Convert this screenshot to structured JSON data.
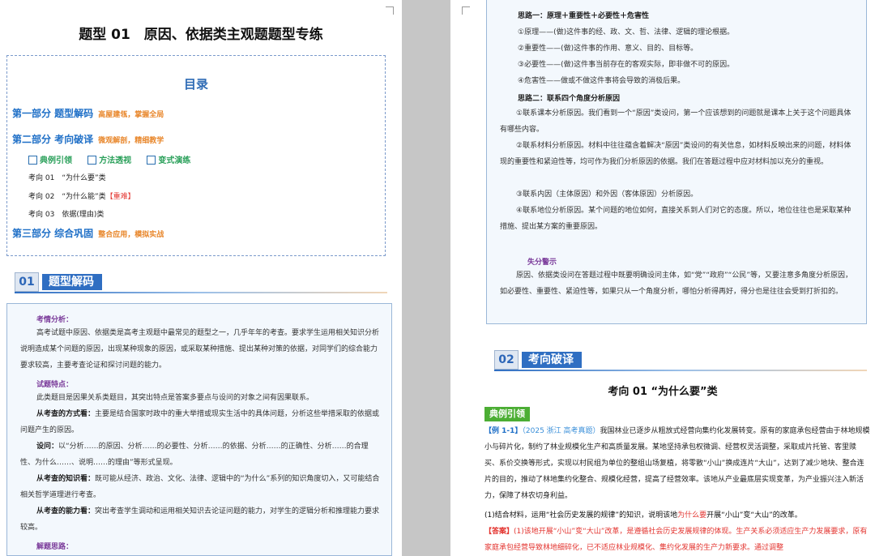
{
  "left_page": {
    "title": "题型 01　原因、依据类主观题题型专练",
    "toc": {
      "title": "目录",
      "parts": [
        {
          "label": "第一部分 题型解码",
          "tag": "高屋建瓴，掌握全局"
        },
        {
          "label": "第二部分 考向破译",
          "tag": "微观解剖，精细教学"
        },
        {
          "label": "第三部分 综合巩固",
          "tag": "整合应用，模拟实战"
        }
      ],
      "sublinks": [
        "典例引领",
        "方法透视",
        "变式演练"
      ],
      "items": [
        {
          "text": "考向 01　“为什么要”类",
          "extra": ""
        },
        {
          "text": "考向 02　“为什么能”类",
          "extra": "【重难】"
        },
        {
          "text": "考向 03　依据(理由)类",
          "extra": ""
        }
      ]
    },
    "section": {
      "num": "01",
      "name": "题型解码"
    },
    "analysis": {
      "h1": "考情分析：",
      "p1": "高考试题中原因、依据类是高考主观题中最常见的题型之一，几乎年年的考查。要求学生运用相关知识分析说明造成某个问题的原因，出现某种现象的原因，或采取某种措施、提出某种对策的依据，对同学们的综合能力要求较高，主要考查论证和探讨问题的能力。",
      "h2": "试题特点：",
      "p2": "此类题目是因果关系类题目，其突出特点是答案多要点与设问的对象之间有因果联系。",
      "p3_kw": "从考查的方式看：",
      "p3": "主要是结合国家时政中的重大举措或现实生活中的具体问题，分析这些举措采取的依据或问题产生的原因。",
      "p4_kw": "设问：",
      "p4": "以“分析……的原因、分析……的必要性、分析……的依据、分析……的正确性、分析……的合理性、为什么……、说明……的理由”等形式呈现。",
      "p5_kw": "从考查的知识看：",
      "p5": "既可能从经济、政治、文化、法律、逻辑中的“为什么”系列的知识角度切入，又可能结合相关哲学道理进行考查。",
      "p6_kw": "从考查的能力看：",
      "p6": "突出考查学生调动和运用相关知识去论证问题的能力，对学生的逻辑分析和推理能力要求较高。",
      "h3": "解题思路："
    }
  },
  "right_page": {
    "idea1": {
      "title": "思路一：原理＋重要性＋必要性＋危害性",
      "lines": [
        "①原理——(做)这件事的经、政、文、哲、法律、逻辑的理论根据。",
        "②重要性——(做)这件事的作用、意义、目的、目标等。",
        "③必要性——(做)这件事当前存在的客观实际，即非做不可的原因。",
        "④危害性——做或不做这件事将会导致的消极后果。"
      ]
    },
    "idea2": {
      "title": "思路二：联系四个角度分析原因",
      "lines": [
        "①联系课本分析原因。我们看到一个“原因”类设问，第一个应该想到的问题就是课本上关于这个问题具体有哪些内容。",
        "②联系材料分析原因。材料中往往蕴含着解决“原因”类设问的有关信息，如材料反映出来的问题，材料体现的重要性和紧迫性等，均可作为我们分析原因的依据。我们在答题过程中应对材料加以充分的重视。",
        "③联系内因（主体原因）和外因（客体原因）分析原因。",
        "④联系地位分析原因。某个问题的地位如何，直接关系到人们对它的态度。所以，地位往往也是采取某种措施、提出某方案的重要原因。"
      ]
    },
    "warning": {
      "title": "失分警示",
      "text": "原因、依据类设问在答题过程中既要明确设问主体，如“党”“政府”“公民”等，又要注意多角度分析原因，如必要性、重要性、紧迫性等，如果只从一个角度分析，哪怕分析得再好，得分也是往往会受到打折扣的。"
    },
    "section": {
      "num": "02",
      "name": "考向破译"
    },
    "topic_title": "考向 01 “为什么要”类",
    "example_tag": "典例引领",
    "example": {
      "label": "【例 1-1】",
      "source": "（2025 浙江 高考真题）",
      "text": "我国林业已逐步从粗放式经营向集约化发展转变。原有的家庭承包经营由于林地规模小与碎片化，制约了林业规模化生产和高质量发展。某地坚持承包权微调、经营权灵活调整，采取成片托管、客里赎买、系价交换等形式，实现以村民组为单位的整组山场复植，将零散“小山”换成连片“大山”，达到了减少地块、整合连片的目的，推动了林地集约化整合、规模化经营，提高了经营效率。该地从产业最底层实现变革，为产业振兴注入新活力，保障了林农切身利益。",
      "question_pre": "(1)结合材料，运用“社会历史发展的规律”的知识，说明该地",
      "question_hl": "为什么要",
      "question_post": "开展“小山”变“大山”的改革。",
      "answer_label": "【答案】",
      "answer": "(1)该地开展“小山”变“大山”改革，是遵循社会历史发展规律的体现。生产关系必须适应生产力发展要求，原有家庭承包经营导致林地细碎化，已不适应林业规模化、集约化发展的生产力新要求。通过调整"
    }
  }
}
